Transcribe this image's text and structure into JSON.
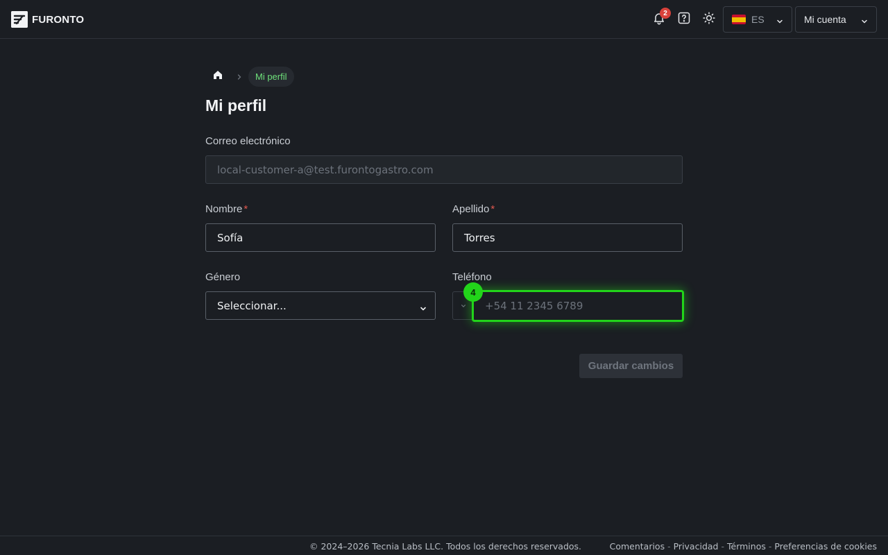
{
  "header": {
    "brand": "FURONTO",
    "notifications_count": "2",
    "language": {
      "code": "ES",
      "flag": "spain-flag-icon"
    },
    "account_label": "Mi cuenta",
    "icons": [
      "bell-icon",
      "help-icon",
      "sun-icon",
      "chevron-down-icon"
    ]
  },
  "breadcrumb": {
    "home_icon": "home-icon",
    "current": "Mi perfil"
  },
  "page": {
    "title": "Mi perfil"
  },
  "form": {
    "email": {
      "label": "Correo electrónico",
      "value": "local-customer-a@test.furontogastro.com",
      "disabled": true
    },
    "first_name": {
      "label": "Nombre",
      "required_mark": "*",
      "value": "Sofía"
    },
    "last_name": {
      "label": "Apellido",
      "required_mark": "*",
      "value": "Torres"
    },
    "gender": {
      "label": "Género",
      "value": "Seleccionar..."
    },
    "phone": {
      "label": "Teléfono",
      "placeholder": "+54 11 2345 6789"
    },
    "save_label": "Guardar cambios"
  },
  "highlight_marker": "4",
  "footer": {
    "copyright": "© 2024–2026 Tecnia Labs LLC. Todos los derechos reservados.",
    "links": [
      "Comentarios",
      "Privacidad",
      "Términos",
      "Preferencias de cookies"
    ],
    "separator": "-"
  },
  "colors": {
    "background": "#1b1e23",
    "accent_green": "#22d41a",
    "breadcrumb_green": "#6ee07a",
    "required_red": "#e0584f",
    "badge_red": "#d9423b"
  }
}
